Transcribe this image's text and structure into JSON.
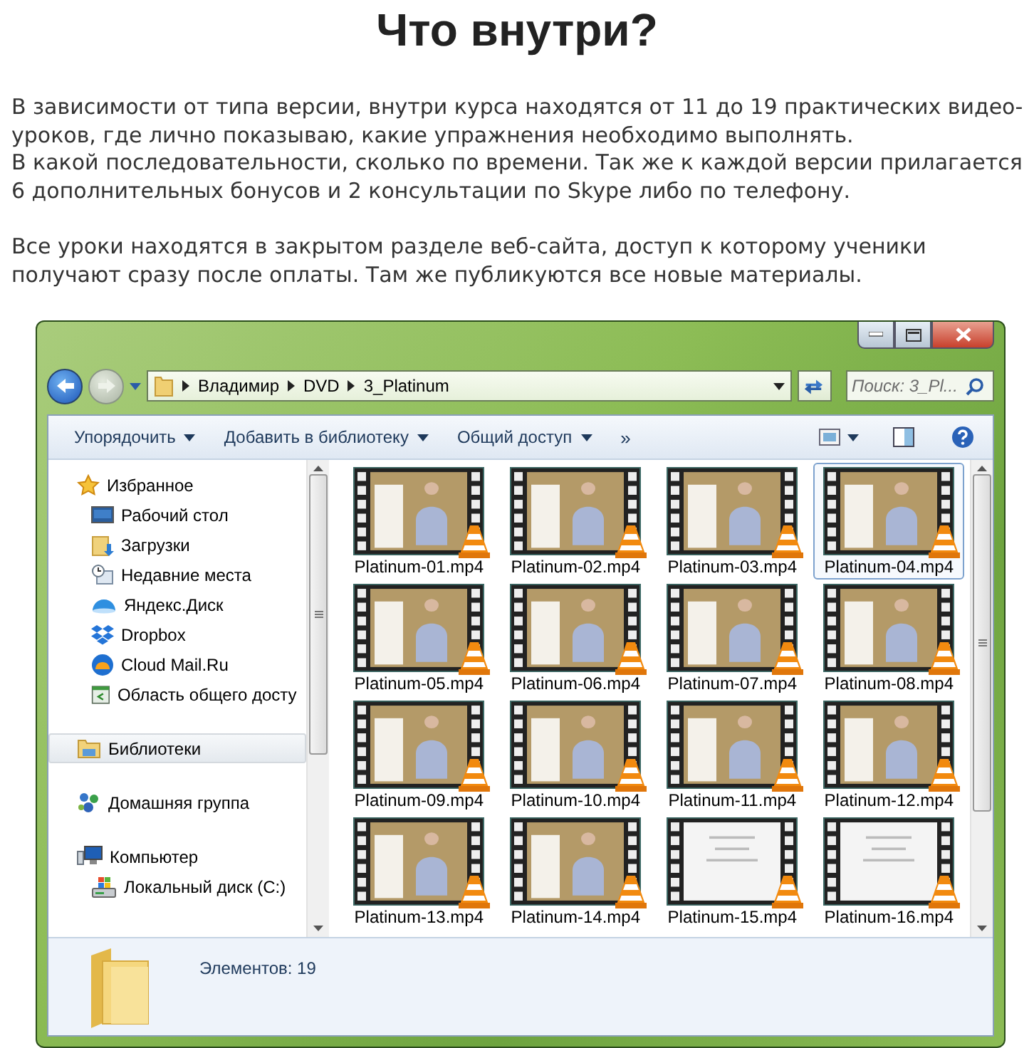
{
  "heading": "Что внутри?",
  "paragraphs": [
    "В зависимости от типа версии, внутри курса находятся от 11 до 19 практических видео-уроков, где лично показываю, какие упражнения необходимо выполнять.",
    "В какой последовательности, сколько по времени. Так же к каждой версии прилагается 6 дополнительных бонусов и 2 консультации по Skype либо по телефону.",
    "Все уроки находятся в закрытом разделе веб-сайта, доступ к которому ученики получают сразу после оплаты. Там же публикуются все новые материалы."
  ],
  "window": {
    "breadcrumb": [
      "Владимир",
      "DVD",
      "3_Platinum"
    ],
    "search": {
      "placeholder": "Поиск: 3_Pl..."
    },
    "toolbar": [
      "Упорядочить",
      "Добавить в библиотеку",
      "Общий доступ"
    ],
    "toolbar_more": "»",
    "nav": [
      {
        "label": "Избранное",
        "kind": "star",
        "selected": false,
        "children": [
          {
            "label": "Рабочий стол",
            "kind": "desktop",
            "selected": false
          },
          {
            "label": "Загрузки",
            "kind": "downloads",
            "selected": false
          },
          {
            "label": "Недавние места",
            "kind": "recent",
            "selected": false
          },
          {
            "label": "Яндекс.Диск",
            "kind": "cloud",
            "selected": false
          },
          {
            "label": "Dropbox",
            "kind": "dropbox",
            "selected": false
          },
          {
            "label": "Cloud Mail.Ru",
            "kind": "mailru",
            "selected": false
          },
          {
            "label": "Область общего досту",
            "kind": "share",
            "selected": false
          }
        ]
      },
      {
        "label": "Библиотеки",
        "kind": "library",
        "selected": true
      },
      {
        "label": "Домашняя группа",
        "kind": "homegroup",
        "selected": false
      },
      {
        "label": "Компьютер",
        "kind": "computer",
        "selected": false,
        "children": [
          {
            "label": "Локальный диск (C:)",
            "kind": "disk",
            "selected": false
          }
        ]
      }
    ],
    "files": [
      {
        "name": "Platinum-01.mp4",
        "kind": "video",
        "selected": false
      },
      {
        "name": "Platinum-02.mp4",
        "kind": "video",
        "selected": false
      },
      {
        "name": "Platinum-03.mp4",
        "kind": "video",
        "selected": false
      },
      {
        "name": "Platinum-04.mp4",
        "kind": "video",
        "selected": true
      },
      {
        "name": "Platinum-05.mp4",
        "kind": "video",
        "selected": false
      },
      {
        "name": "Platinum-06.mp4",
        "kind": "video",
        "selected": false
      },
      {
        "name": "Platinum-07.mp4",
        "kind": "video",
        "selected": false
      },
      {
        "name": "Platinum-08.mp4",
        "kind": "video",
        "selected": false
      },
      {
        "name": "Platinum-09.mp4",
        "kind": "video",
        "selected": false
      },
      {
        "name": "Platinum-10.mp4",
        "kind": "video",
        "selected": false
      },
      {
        "name": "Platinum-11.mp4",
        "kind": "video",
        "selected": false
      },
      {
        "name": "Platinum-12.mp4",
        "kind": "video",
        "selected": false
      },
      {
        "name": "Platinum-13.mp4",
        "kind": "video",
        "selected": false
      },
      {
        "name": "Platinum-14.mp4",
        "kind": "video",
        "selected": false
      },
      {
        "name": "Platinum-15.mp4",
        "kind": "slide",
        "selected": false
      },
      {
        "name": "Platinum-16.mp4",
        "kind": "slide",
        "selected": false
      }
    ],
    "status": "Элементов: 19"
  }
}
